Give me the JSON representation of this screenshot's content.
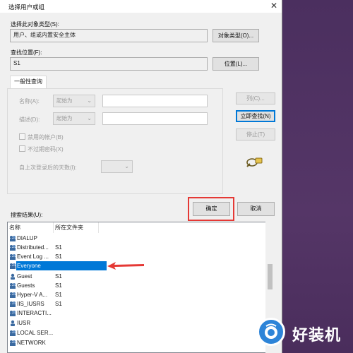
{
  "window": {
    "title": "选择用户或组",
    "close_glyph": "✕"
  },
  "object_type": {
    "label": "选择此对象类型(S):",
    "value": "用户、组或内置安全主体",
    "button": "对象类型(O)..."
  },
  "location": {
    "label": "查找位置(F):",
    "value": "S1",
    "button": "位置(L)..."
  },
  "query": {
    "tab": "一般性查询",
    "name_label": "名称(A):",
    "name_mode": "起始为",
    "desc_label": "描述(D):",
    "desc_mode": "起始为",
    "disabled_accounts": "禁用的帐户(B)",
    "no_expire_pwd": "不过期密码(X)",
    "days_label": "自上次登录后的天数(I):"
  },
  "buttons": {
    "columns": "列(C)...",
    "find_now": "立即查找(N)",
    "stop": "停止(T)",
    "ok": "确定",
    "cancel": "取消"
  },
  "results": {
    "label": "搜索结果(U):",
    "headers": [
      "名称",
      "所在文件夹"
    ],
    "rows": [
      {
        "name": "DIALUP",
        "folder": "",
        "icon": "group-icon"
      },
      {
        "name": "Distributed...",
        "folder": "S1",
        "icon": "group-icon"
      },
      {
        "name": "Event Log ...",
        "folder": "S1",
        "icon": "group-icon"
      },
      {
        "name": "Everyone",
        "folder": "",
        "icon": "group-icon",
        "selected": true
      },
      {
        "name": "Guest",
        "folder": "S1",
        "icon": "user-icon"
      },
      {
        "name": "Guests",
        "folder": "S1",
        "icon": "group-icon"
      },
      {
        "name": "Hyper-V A...",
        "folder": "S1",
        "icon": "group-icon"
      },
      {
        "name": "IIS_IUSRS",
        "folder": "S1",
        "icon": "group-icon"
      },
      {
        "name": "INTERACTI...",
        "folder": "",
        "icon": "group-icon"
      },
      {
        "name": "IUSR",
        "folder": "",
        "icon": "user-icon"
      },
      {
        "name": "LOCAL SER...",
        "folder": "",
        "icon": "group-icon"
      },
      {
        "name": "NETWORK",
        "folder": "",
        "icon": "group-icon"
      }
    ]
  },
  "watermark": {
    "text": "好装机"
  },
  "colors": {
    "accent": "#0078d7",
    "highlight_box": "#e53935",
    "arrow": "#e53935",
    "desktop": "#4a2f5e"
  }
}
